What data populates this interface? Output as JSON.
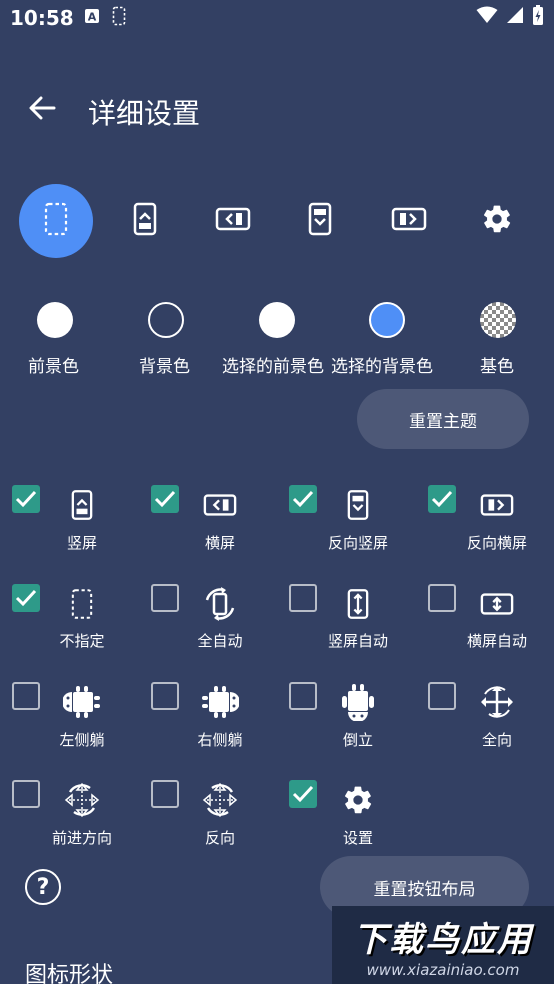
{
  "status_bar": {
    "time": "10:58",
    "left_icons": [
      "font-a-icon",
      "dashed-phone-icon"
    ],
    "right_icons": [
      "wifi-icon",
      "signal-icon",
      "battery-charging-icon"
    ]
  },
  "header": {
    "back_icon": "arrow-left-icon",
    "title": "详细设置"
  },
  "mode_tabs": [
    {
      "name": "unspecified",
      "icon": "dashed-phone-icon",
      "selected": true
    },
    {
      "name": "portrait",
      "icon": "portrait-phone-icon",
      "selected": false
    },
    {
      "name": "landscape",
      "icon": "landscape-phone-icon",
      "selected": false
    },
    {
      "name": "reverse-portrait",
      "icon": "reverse-portrait-icon",
      "selected": false
    },
    {
      "name": "reverse-landscape",
      "icon": "reverse-landscape-icon",
      "selected": false
    },
    {
      "name": "settings",
      "icon": "gear-icon",
      "selected": false
    }
  ],
  "colors": [
    {
      "label": "前景色",
      "color": "#ffffff",
      "style": "filled"
    },
    {
      "label": "背景色",
      "color": "#334063",
      "style": "outline"
    },
    {
      "label": "选择的前景色",
      "color": "#ffffff",
      "style": "filled"
    },
    {
      "label": "选择的背景色",
      "color": "#4f8ff6",
      "style": "filled"
    },
    {
      "label": "基色",
      "color": "checker",
      "style": "checker"
    }
  ],
  "reset_theme_label": "重置主题",
  "options": [
    {
      "label": "竖屏",
      "checked": true,
      "icon": "portrait-phone-icon"
    },
    {
      "label": "横屏",
      "checked": true,
      "icon": "landscape-phone-icon"
    },
    {
      "label": "反向竖屏",
      "checked": true,
      "icon": "reverse-portrait-icon"
    },
    {
      "label": "反向横屏",
      "checked": true,
      "icon": "reverse-landscape-icon"
    },
    {
      "label": "不指定",
      "checked": true,
      "icon": "dashed-phone-icon"
    },
    {
      "label": "全自动",
      "checked": false,
      "icon": "auto-rotate-icon"
    },
    {
      "label": "竖屏自动",
      "checked": false,
      "icon": "portrait-auto-icon"
    },
    {
      "label": "横屏自动",
      "checked": false,
      "icon": "landscape-auto-icon"
    },
    {
      "label": "左侧躺",
      "checked": false,
      "icon": "android-left-icon"
    },
    {
      "label": "右侧躺",
      "checked": false,
      "icon": "android-right-icon"
    },
    {
      "label": "倒立",
      "checked": false,
      "icon": "android-upside-down-icon"
    },
    {
      "label": "全向",
      "checked": false,
      "icon": "all-directions-icon"
    },
    {
      "label": "前进方向",
      "checked": false,
      "icon": "forward-direction-icon"
    },
    {
      "label": "反向",
      "checked": false,
      "icon": "reverse-direction-icon"
    },
    {
      "label": "设置",
      "checked": true,
      "icon": "gear-icon"
    }
  ],
  "reset_layout_label": "重置按钮布局",
  "help_icon": "?",
  "section_title": "图标形状",
  "watermark": {
    "main": "下载鸟应用",
    "sub": "www.xiazainiao.com"
  },
  "accent_colors": {
    "background": "#334063",
    "selected": "#4f8ff6",
    "checkbox": "#2e9a89",
    "pill": "#4d5877"
  }
}
